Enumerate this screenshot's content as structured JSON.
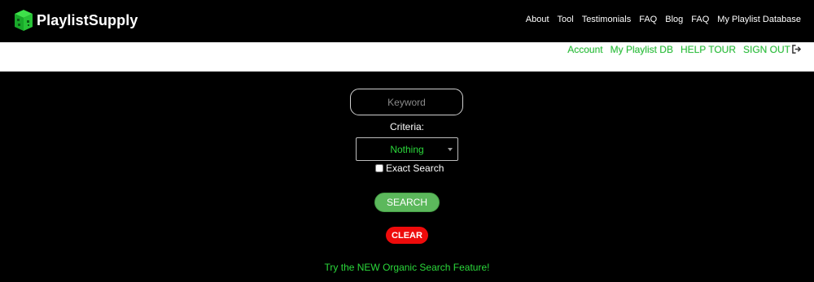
{
  "brand": {
    "name": "PlaylistSupply",
    "logo_icon": "green-cube-logo-icon"
  },
  "nav": {
    "items": [
      "About",
      "Tool",
      "Testimonials",
      "FAQ",
      "Blog",
      "FAQ",
      "My Playlist Database"
    ]
  },
  "userbar": {
    "links": [
      "Account",
      "My Playlist DB",
      "HELP TOUR",
      "SIGN OUT"
    ],
    "signout_icon": "sign-out-icon"
  },
  "search": {
    "keyword_placeholder": "Keyword",
    "keyword_value": "",
    "criteria_label": "Criteria:",
    "criteria_selected": "Nothing",
    "exact_label": "Exact Search",
    "exact_checked": false,
    "search_label": "SEARCH",
    "clear_label": "CLEAR"
  },
  "organic_link": "Try the NEW Organic Search Feature!",
  "colors": {
    "accent_green": "#2bd93b",
    "search_button": "#5cb85c",
    "clear_button": "#ee0b0b"
  }
}
